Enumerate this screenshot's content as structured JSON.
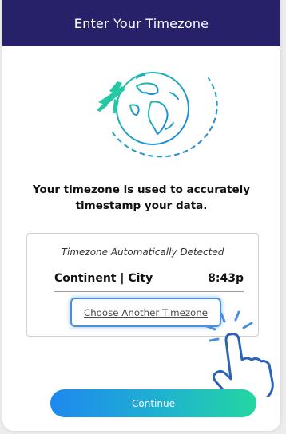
{
  "header": {
    "title": "Enter Your Timezone"
  },
  "illustration": {
    "icons": [
      "airplane-icon",
      "globe-icon"
    ]
  },
  "info": {
    "text": "Your timezone is used to accurately timestamp your data."
  },
  "timezone_card": {
    "auto_label": "Timezone Automatically Detected",
    "location": "Continent | City",
    "time": "8:43p",
    "choose_label": "Choose Another Timezone"
  },
  "cursor": {
    "icon": "pointing-hand-icon"
  },
  "footer": {
    "continue_label": "Continue"
  },
  "colors": {
    "header_bg": "#27216a",
    "accent_blue": "#1e88ee",
    "accent_teal": "#24d6a0",
    "focus_ring": "#4a8ee0"
  }
}
